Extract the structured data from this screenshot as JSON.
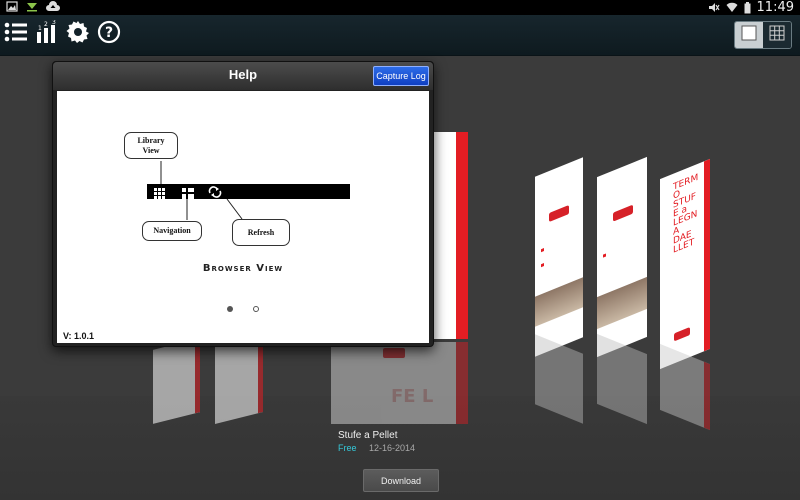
{
  "status_bar": {
    "time": "11:49",
    "icons": [
      "image-notification-icon",
      "download-notification-icon",
      "cloud-upload-icon",
      "mute-icon",
      "wifi-icon",
      "battery-icon"
    ]
  },
  "action_bar": {
    "icons": [
      "list-icon",
      "ranking-icon",
      "gear-icon",
      "help-icon"
    ],
    "view_toggle": {
      "options": [
        "single-view",
        "grid-view"
      ],
      "active": "single-view"
    }
  },
  "help_dialog": {
    "title": "Help",
    "capture_button": "Capture Log",
    "callouts": {
      "library_view": "Library View",
      "navigation": "Navigation",
      "refresh": "Refresh"
    },
    "heading": "Browser View",
    "version": "V: 1.0.1",
    "pager": {
      "count": 2,
      "active": 1
    }
  },
  "carousel": {
    "selected_book": {
      "title": "Stufe a Pellet",
      "price": "Free",
      "date": "12-16-2014"
    },
    "download_label": "Download",
    "cover_vertical_text": "TERMO STUFE a LEGNA DAE LLET",
    "accent_color": "#e31d23"
  }
}
